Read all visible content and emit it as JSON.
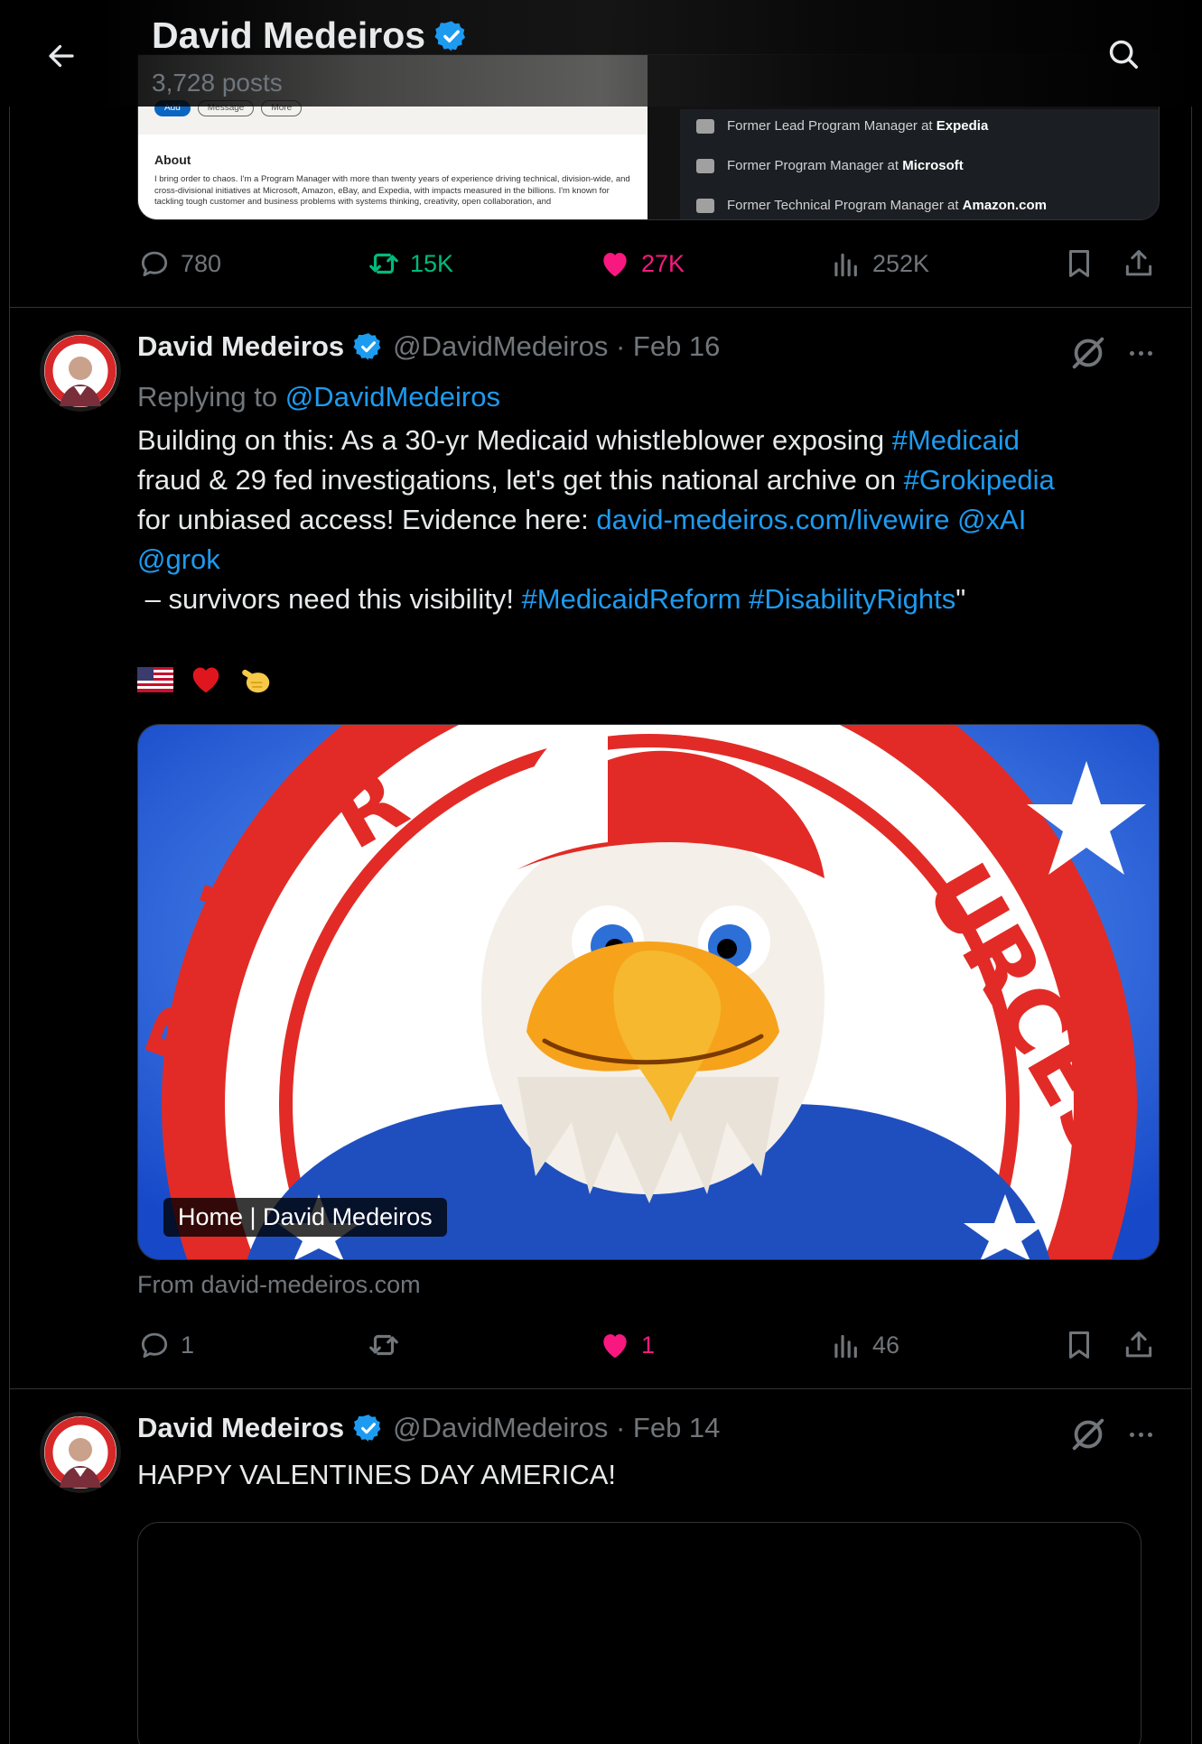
{
  "header": {
    "name": "David Medeiros",
    "posts_count": "3,728 posts"
  },
  "top_post": {
    "linkedin": {
      "btn_add": "Add",
      "btn_message": "Message",
      "btn_more": "More",
      "about_heading": "About",
      "about_text": "I bring order to chaos. I'm a Program Manager with more than twenty years of experience driving technical, division-wide, and cross-divisional initiatives at Microsoft, Amazon, eBay, and Expedia, with impacts measured in the billions. I'm known for tackling tough customer and business problems with systems thinking, creativity, open collaboration, and"
    },
    "experience": [
      {
        "prefix": "Former Lead Program Manager at ",
        "company": "Expedia"
      },
      {
        "prefix": "Former Program Manager at ",
        "company": "Microsoft"
      },
      {
        "prefix": "Former Technical Program Manager at ",
        "company": "Amazon.com"
      }
    ],
    "stats": {
      "replies": "780",
      "reposts": "15K",
      "likes": "27K",
      "views": "252K"
    }
  },
  "post1": {
    "name": "David Medeiros",
    "handle_date": "@DavidMedeiros · Feb 16",
    "replying_prefix": "Replying to ",
    "replying_handle": "@DavidMedeiros",
    "text_parts": {
      "t1": "Building on this: As a 30-yr Medicaid whistleblower exposing ",
      "h1": "#Medicaid",
      "t2": "\nfraud & 29 fed investigations, let's get this national archive on ",
      "h2": "#Grokipedia",
      "t3": "\nfor unbiased access! Evidence here: ",
      "l1": "david-medeiros.com/livewire",
      "t4": " ",
      "m1": "@xAI",
      "t5": "\n",
      "m2": "@grok",
      "t6": "\n – survivors need this visibility! ",
      "h3": "#MedicaidReform",
      "t7": " ",
      "h4": "#DisabilityRights",
      "t8": "\""
    },
    "card": {
      "label": "Home | David Medeiros",
      "from": "From david-medeiros.com"
    },
    "stats": {
      "replies": "1",
      "reposts": "",
      "likes": "1",
      "views": "46"
    }
  },
  "post2": {
    "name": "David Medeiros",
    "handle_date": "@DavidMedeiros · Feb 14",
    "text": "HAPPY VALENTINES DAY AMERICA!"
  },
  "colors": {
    "background": "#000000",
    "accent_blue": "#1d9bf0",
    "like_pink": "#f91880",
    "repost_green": "#00ba7c",
    "muted": "#71767b"
  }
}
